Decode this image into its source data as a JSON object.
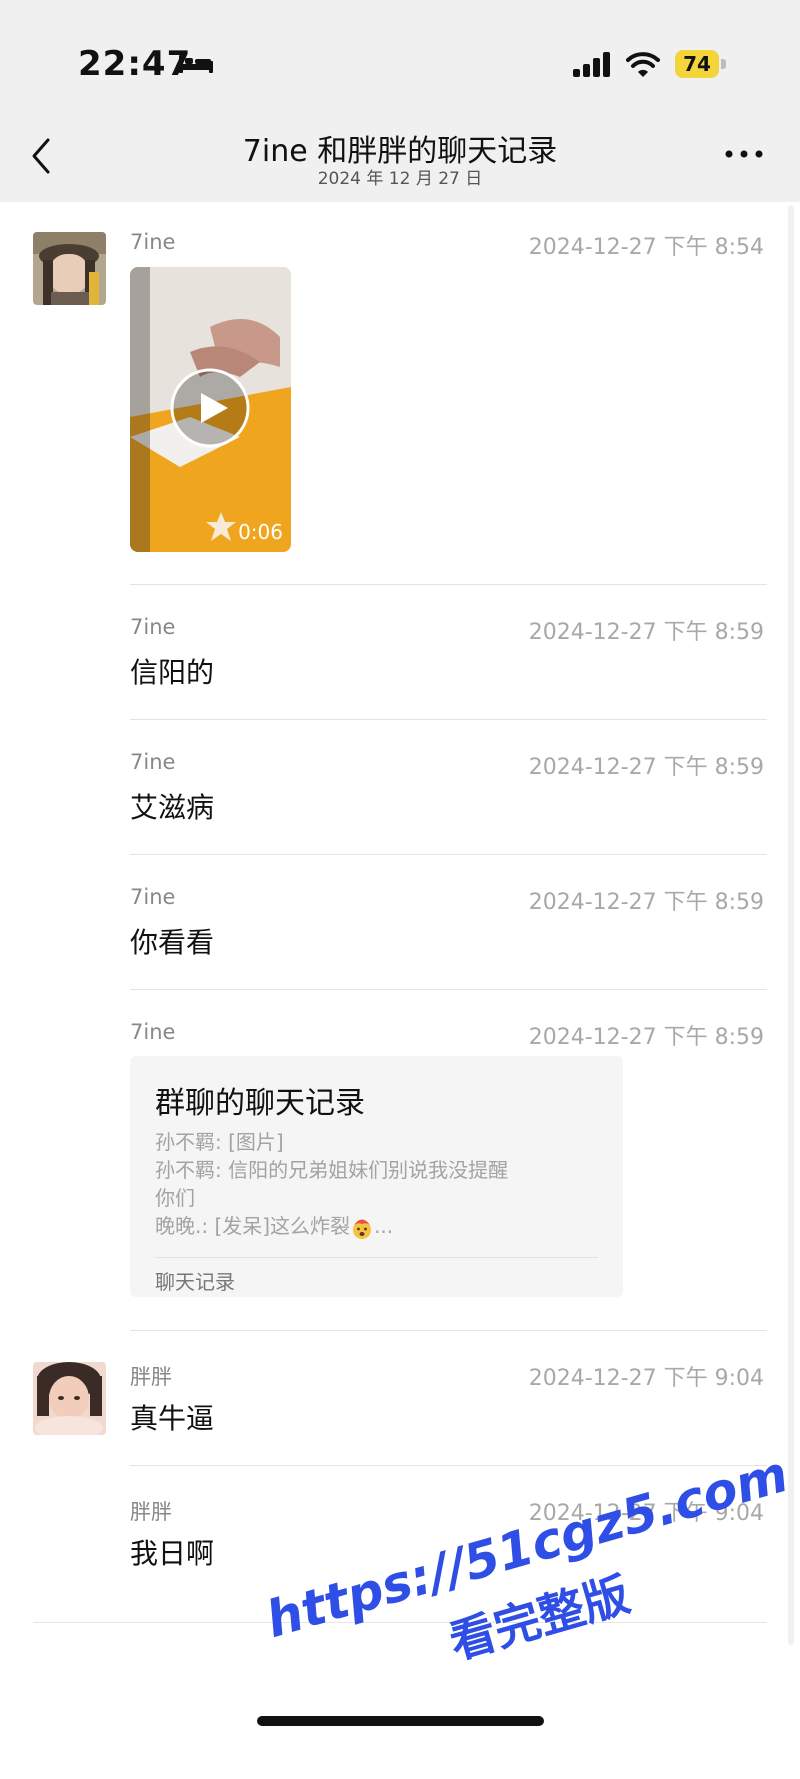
{
  "status_bar": {
    "time": "22:47",
    "battery": "74"
  },
  "header": {
    "title": "7ine 和胖胖的聊天记录",
    "subtitle": "2024 年 12 月 27 日"
  },
  "messages": [
    {
      "sender": "7ine",
      "time": "2024-12-27 下午 8:54",
      "type": "video",
      "duration": "0:06"
    },
    {
      "sender": "7ine",
      "time": "2024-12-27 下午 8:59",
      "text": "信阳的"
    },
    {
      "sender": "7ine",
      "time": "2024-12-27 下午 8:59",
      "text": "艾滋病"
    },
    {
      "sender": "7ine",
      "time": "2024-12-27 下午 8:59",
      "text": "你看看"
    },
    {
      "sender": "7ine",
      "time": "2024-12-27 下午 8:59",
      "type": "chat_record",
      "card": {
        "title": "群聊的聊天记录",
        "line1": "孙不羁: [图片]",
        "line2": "孙不羁: 信阳的兄弟姐妹们别说我没提醒",
        "line3": "你们",
        "line4_prefix": "晚晚.: [发呆]这么炸裂",
        "line4_suffix": "...",
        "footer": "聊天记录"
      }
    },
    {
      "sender": "胖胖",
      "time": "2024-12-27 下午 9:04",
      "text": "真牛逼"
    },
    {
      "sender": "胖胖",
      "time": "2024-12-27 下午 9:04",
      "text": "我日啊"
    }
  ],
  "watermark": {
    "url": "https://51cgz5.com",
    "text": "看完整版"
  }
}
